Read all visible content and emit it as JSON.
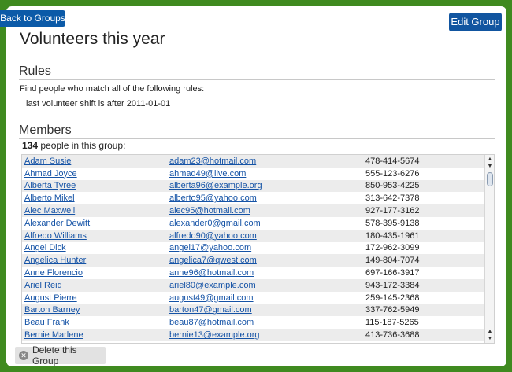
{
  "header": {
    "back_label": "Back to Groups",
    "edit_label": "Edit Group",
    "title": "Volunteers this year"
  },
  "rules": {
    "heading": "Rules",
    "intro": "Find people who match all of the following rules:",
    "items": [
      "last volunteer shift is after 2011-01-01"
    ]
  },
  "members": {
    "heading": "Members",
    "count": "134",
    "count_suffix": " people in this group:",
    "rows": [
      {
        "name": "Adam Susie",
        "email": "adam23@hotmail.com",
        "phone": "478-414-5674"
      },
      {
        "name": "Ahmad Joyce",
        "email": "ahmad49@live.com",
        "phone": "555-123-6276"
      },
      {
        "name": "Alberta Tyree",
        "email": "alberta96@example.org",
        "phone": "850-953-4225"
      },
      {
        "name": "Alberto Mikel",
        "email": "alberto95@yahoo.com",
        "phone": "313-642-7378"
      },
      {
        "name": "Alec Maxwell",
        "email": "alec95@hotmail.com",
        "phone": "927-177-3162"
      },
      {
        "name": "Alexander Dewitt",
        "email": "alexander0@gmail.com",
        "phone": "578-395-9138"
      },
      {
        "name": "Alfredo Williams",
        "email": "alfredo90@yahoo.com",
        "phone": "180-435-1961"
      },
      {
        "name": "Angel Dick",
        "email": "angel17@yahoo.com",
        "phone": "172-962-3099"
      },
      {
        "name": "Angelica Hunter",
        "email": "angelica7@qwest.com",
        "phone": "149-804-7074"
      },
      {
        "name": "Anne Florencio",
        "email": "anne96@hotmail.com",
        "phone": "697-166-3917"
      },
      {
        "name": "Ariel Reid",
        "email": "ariel80@example.com",
        "phone": "943-172-3384"
      },
      {
        "name": "August Pierre",
        "email": "august49@gmail.com",
        "phone": "259-145-2368"
      },
      {
        "name": "Barton Barney",
        "email": "barton47@gmail.com",
        "phone": "337-762-5949"
      },
      {
        "name": "Beau Frank",
        "email": "beau87@hotmail.com",
        "phone": "115-187-5265"
      },
      {
        "name": "Bernie Marlene",
        "email": "bernie13@example.org",
        "phone": "413-736-3688"
      }
    ]
  },
  "footer": {
    "delete_label": "Delete this Group"
  },
  "colors": {
    "background": "#3f8a1f",
    "button_blue": "#0b5aa8",
    "link_blue": "#1553a6"
  }
}
